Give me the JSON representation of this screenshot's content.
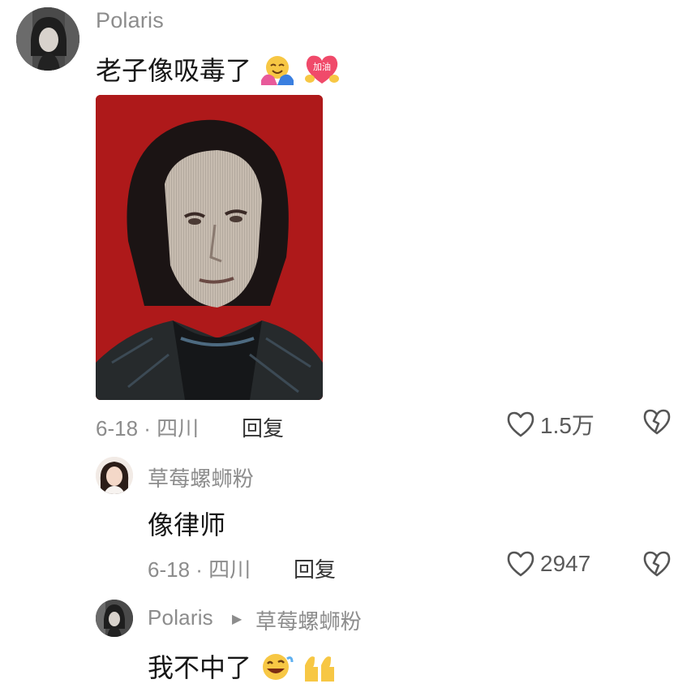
{
  "comment": {
    "username": "Polaris",
    "text": "老子像吸毒了",
    "emojis": [
      "hug-emoji",
      "cheer-heart-sticker"
    ],
    "sticker_text": "加油",
    "meta": "6-18 · 四川",
    "reply_label": "回复",
    "likes": "1.5万"
  },
  "replies": [
    {
      "username": "草莓螺蛳粉",
      "text": "像律师",
      "meta": "6-18 · 四川",
      "reply_label": "回复",
      "likes": "2947"
    },
    {
      "username": "Polaris",
      "reply_to": "草莓螺蛳粉",
      "text": "我不中了",
      "emojis": [
        "laughing-emoji",
        "thumbs-up-emoji"
      ]
    }
  ],
  "colors": {
    "secondary_text": "#8c8c8c",
    "primary_text": "#161616",
    "photo_background": "#b51b1c"
  }
}
